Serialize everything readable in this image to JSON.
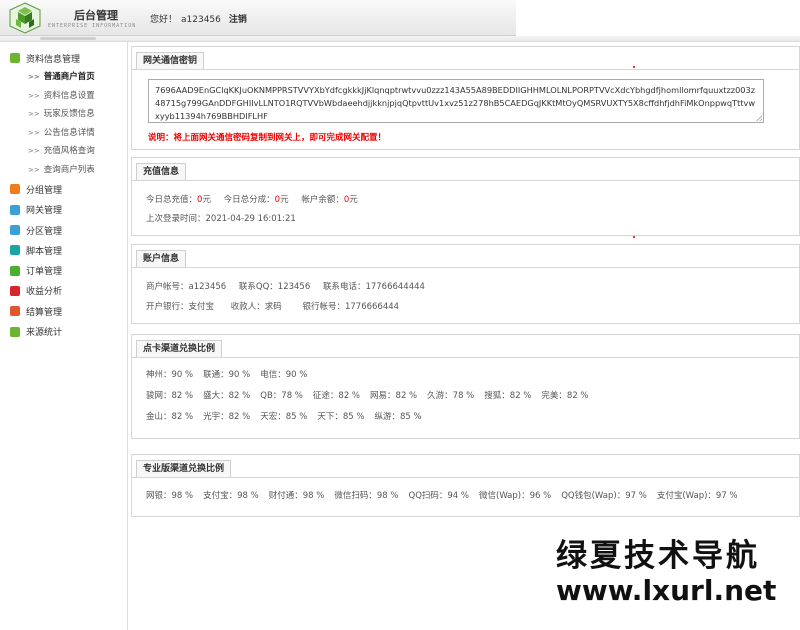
{
  "header": {
    "app_title": "后台管理",
    "app_subtitle": "ENTERPRISE INFORMATION",
    "greeting": "您好！",
    "username": "a123456",
    "logout_label": "注销"
  },
  "sidebar": {
    "groups": [
      {
        "label": "资料信息管理",
        "icon": "power-icon",
        "color": "#6cb52d",
        "children": [
          {
            "label": "普通商户首页"
          },
          {
            "label": "资料信息设置"
          },
          {
            "label": "玩家反馈信息"
          },
          {
            "label": "公告信息详情"
          },
          {
            "label": "充值风格查询"
          },
          {
            "label": "查询商户列表"
          }
        ]
      },
      {
        "label": "分组管理",
        "icon": "pencil-icon",
        "color": "#f07c1b"
      },
      {
        "label": "网关管理",
        "icon": "window-icon",
        "color": "#3aa0d8"
      },
      {
        "label": "分区管理",
        "icon": "window-icon",
        "color": "#3aa0d8"
      },
      {
        "label": "脚本管理",
        "icon": "grid-icon",
        "color": "#1aa5a5"
      },
      {
        "label": "订单管理",
        "icon": "recycle-icon",
        "color": "#4cae2d"
      },
      {
        "label": "收益分析",
        "icon": "box-icon",
        "color": "#d8242b"
      },
      {
        "label": "结算管理",
        "icon": "briefcase-icon",
        "color": "#e1562a"
      },
      {
        "label": "来源统计",
        "icon": "gear-icon",
        "color": "#6cb52d"
      }
    ]
  },
  "gateway": {
    "title": "网关通信密钥",
    "secret": "7696AAD9EnGClqKKJuOKNMPPRSTVVYXbYdfcgkkkJjKlqnqptrwtvvu0zzz143A55A89BEDDIIGHHMLOLNLPORPTVVcXdcYbhgdfjhomllomrfquuxtzz003z48715g799GAnDDFGHIIvLLNTO1RQTVVbWbdaeehdjjkknjpjqQtpvttUv1xvz51z278hB5CAEDGqJKKtMtOyQMSRVUXTY5X8cffdhfjdhFiMkOnppwqTttvwxyyb11394h769BBHDIFLHF",
    "note": "说明：将上面网关通信密码复制到网关上，即可完成网关配置！"
  },
  "recharge": {
    "title": "充值信息",
    "today_recharge_label": "今日总充值：",
    "today_recharge_value": "0",
    "today_share_label": "今日总分成：",
    "today_share_value": "0",
    "balance_label": "帐户余额：",
    "balance_value": "0",
    "unit": "元",
    "last_login_label": "上次登录时间：",
    "last_login_value": "2021-04-29 16:01:21"
  },
  "account": {
    "title": "账户信息",
    "merchant_label": "商户帐号：",
    "merchant_value": "a123456",
    "qq_label": "联系QQ：",
    "qq_value": "123456",
    "phone_label": "联系电话：",
    "phone_value": "17766644444",
    "bank_label": "开户银行：",
    "bank_value": "支付宝",
    "payee_label": "收款人：",
    "payee_value": "求码",
    "bank_account_label": "银行帐号：",
    "bank_account_value": "1776666444"
  },
  "card_rates": {
    "title": "点卡渠道兑换比例",
    "rows": [
      [
        {
          "label": "神州：",
          "value": "90 %"
        },
        {
          "label": "联通：",
          "value": "90 %"
        },
        {
          "label": "电信：",
          "value": "90 %"
        }
      ],
      [
        {
          "label": "骏网：",
          "value": "82 %"
        },
        {
          "label": "盛大：",
          "value": "82 %"
        },
        {
          "label": "QB：",
          "value": "78 %"
        },
        {
          "label": "征途：",
          "value": "82 %"
        },
        {
          "label": "网易：",
          "value": "82 %"
        },
        {
          "label": "久游：",
          "value": "78 %"
        },
        {
          "label": "搜狐：",
          "value": "82 %"
        },
        {
          "label": "完美：",
          "value": "82 %"
        }
      ],
      [
        {
          "label": "金山：",
          "value": "82 %"
        },
        {
          "label": "光宇：",
          "value": "82 %"
        },
        {
          "label": "天宏：",
          "value": "85 %"
        },
        {
          "label": "天下：",
          "value": "85 %"
        },
        {
          "label": "纵游：",
          "value": "85 %"
        }
      ]
    ]
  },
  "pro_rates": {
    "title": "专业版渠道兑换比例",
    "items": [
      {
        "label": "网银：",
        "value": "98 %"
      },
      {
        "label": "支付宝：",
        "value": "98 %"
      },
      {
        "label": "财付通：",
        "value": "98 %"
      },
      {
        "label": "微信扫码：",
        "value": "98 %"
      },
      {
        "label": "QQ扫码：",
        "value": "94 %"
      },
      {
        "label": "微信(Wap)：",
        "value": "96 %"
      },
      {
        "label": "QQ钱包(Wap)：",
        "value": "97 %"
      },
      {
        "label": "支付宝(Wap)：",
        "value": "97 %"
      }
    ]
  },
  "watermark": {
    "line1": "绿夏技术导航",
    "line2": "www.lxurl.net"
  }
}
